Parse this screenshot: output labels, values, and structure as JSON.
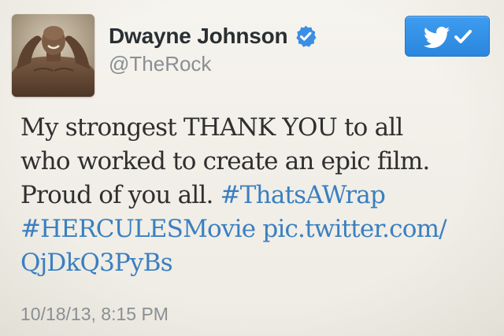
{
  "tweet": {
    "author": {
      "display_name": "Dwayne Johnson",
      "handle": "@TheRock",
      "verified": true
    },
    "body": {
      "line1": "My strongest THANK YOU to all",
      "line2": "who worked to create an epic film.",
      "line3_text": "Proud of you all. ",
      "line3_hashtag": "#ThatsAWrap",
      "line4_hashtag": "#HERCULESMovie",
      "line4_link": "pic.twitter.com/",
      "line5_link": "QjDkQ3PyBs"
    },
    "timestamp": "10/18/13, 8:15 PM"
  },
  "follow_button": {
    "state": "following",
    "icons": [
      "bird-icon",
      "checkmark-icon"
    ]
  },
  "colors": {
    "link": "#3a7fc1",
    "button": "#2a86dc",
    "verified_badge": "#3a8ee6",
    "handle_gray": "#8a8f93"
  }
}
